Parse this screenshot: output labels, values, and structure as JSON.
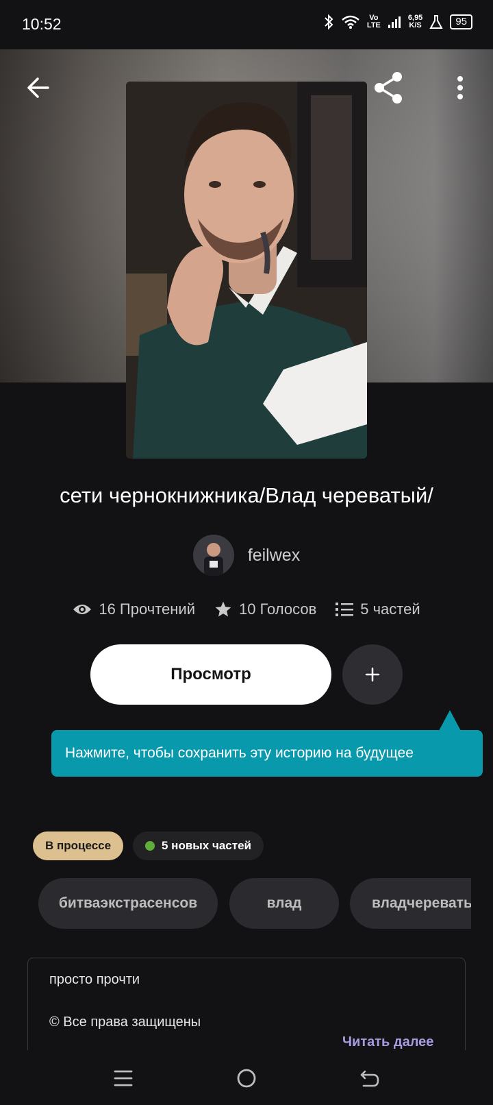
{
  "status_bar": {
    "time": "10:52",
    "network_top": "Vo",
    "network_bottom": "LTE",
    "speed_top": "6,95",
    "speed_bottom": "K/S",
    "battery": "95",
    "icons": [
      "bluetooth-icon",
      "wifi-icon",
      "signal-icon",
      "flask-icon",
      "battery-icon"
    ]
  },
  "header": {
    "back_icon": "arrow-left-icon",
    "share_icon": "share-icon",
    "more_icon": "more-vertical-icon"
  },
  "story": {
    "title": "сети чернокнижника/Влад череватый/",
    "author": "feilwex",
    "reads": "16 Прочтений",
    "votes": "10 Голосов",
    "parts": "5 частей"
  },
  "actions": {
    "view_label": "Просмотр",
    "add_icon": "plus-icon"
  },
  "tooltip": {
    "text": "Нажмите, чтобы сохранить эту историю на будущее"
  },
  "status": {
    "in_progress": "В процессе",
    "new_parts": "5 новых частей"
  },
  "tags": [
    "битваэкстрасенсов",
    "влад",
    "владчереватый"
  ],
  "description": {
    "line1": "просто прочти",
    "line2": "© Все права защищены",
    "read_more": "Читать далее"
  },
  "colors": {
    "background": "#121114",
    "tooltip": "#0899ac",
    "badge_progress": "#dcc08f",
    "read_more": "#a99be0",
    "new_dot": "#5fae3a"
  }
}
